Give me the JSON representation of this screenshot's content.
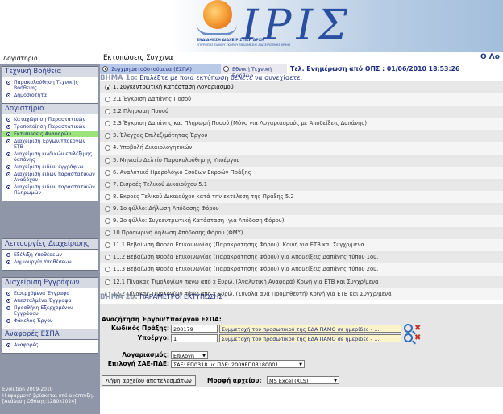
{
  "header": {
    "logo_text": "IPIΣ",
    "logo_subtitle": "ΕΝΔΙΑΜΕΣΗ ΔΙΑΧΕΙΡΙΣΤΙΚΗ ΑΡΧΗ",
    "logo_subtitle2": "ΕΠΙΤΡΟΠΗΣ ΕΙΔΙΚΟΥ ΣΚΟΠΟΥ ΕΝΔΙΑΜΕΣΗΣ ΔΙΑΧΕΙΡΙΣΤΙΚΗΣ ΑΡΧΗΣ"
  },
  "topbar": {
    "left": "Λογιστήριο",
    "title": "Εκτυπώσεις Συγχ/να",
    "right": "Ο Λο"
  },
  "sidebar": {
    "sections": [
      {
        "title": "Τεχνική Βοήθεια",
        "items": [
          "Παρακολούθηση Τεχνικής Βοήθειας",
          "Δημοσιότητα"
        ]
      },
      {
        "title": "Λογιστήριο",
        "items": [
          "Καταχώρηση Παραστατικών",
          "Τροποποίηση Παραστατικών",
          "Εκτυπώσεις Αναφορών",
          "Διαχείριση Έργων/Υποέργων ΕΤΒ",
          "Διαχείριση κωδικών επιλέξιμης δαπάνης",
          "Διαχείριση ειδών εγγράφων",
          "Διαχείριση ειδών παραστατικών Αναδόχου",
          "Διαχείριση ειδών παραστατικών Πληρωμών"
        ]
      },
      {
        "title": "Λειτουργίες Διαχείρισης",
        "items": [
          "Εξέλιξη Υποθέσεων",
          "Δημιουργία Υποθέσεων"
        ]
      },
      {
        "title": "Διαχείριση Εγγράφων",
        "items": [
          "Εισερχόμενα Έγγραφα",
          "Απεσταλμένα Έγγραφα",
          "Προσθήκη Εξερχομένου Εγγράφου",
          "Φάκελος Έργου"
        ]
      },
      {
        "title": "Αναφορές ΕΣΠΑ",
        "items": [
          "Αναφορές"
        ]
      }
    ],
    "active_item": "Εκτυπώσεις Αναφορών",
    "footer": [
      "Evolution 2009-2010",
      "Η εφαρμογή βρίσκεται υπό ανάπτυξη.",
      "[Ανάλυση Οθόνης:1280x1024]"
    ]
  },
  "main": {
    "tabs": [
      {
        "label": "Συγχρηματοδοτούμενα (ΕΣΠΑ)",
        "selected": true
      },
      {
        "label": "Εθνική Τεχνική Βοήθεια",
        "selected": false
      }
    ],
    "last_update": "Τελ. Ενημέρωση από ΟΠΣ : 01/06/2010 18:53:26",
    "step1_label": "ΒΗΜΑ 1ο:",
    "step1_text": "Επιλέξτε με ποια εκτύπωση θέλετε να συνεχίσετε:",
    "options": [
      "1. Συγκεντρωτική Κατάσταση Λογαριασμού",
      "2.1 Έγκριση Δαπάνης Ποσού",
      "2.2 Πληρωμή Ποσού",
      "2.3 Έγκριση Δαπάνης και Πληρωμή Ποσού (Μόνο για Λογαριασμούς με Αποδείξεις Δαπάνης)",
      "3. Έλεγχος Επιλεξιμότητας Έργου",
      "4. Υποβολή Δικαιολογητικών",
      "5. Μηνιαίο Δελτίο Παρακολούθησης Υποέργου",
      "6. Αναλυτικό Ημερολόγιο Εσόδων Εκροών Πράξης",
      "7. Εισροές Τελικού Δικαιούχου 5.1",
      "8. Εκροές Τελικού Δικαιούχου κατά την εκτέλεση της Πράξης 5.2",
      "9. 1ο φύλλο: Δήλωση Απόδοσης Φόρου",
      "9. 2ο φύλλο: Συγκεντρωτική Κατάσταση (για Απόδοση Φόρου)",
      "10.Προσωρινή Δήλωση Απόδοσης Φόρου (ΦΜΥ)",
      "11.1 Βεβαίωση Φορέα Επικοινωνίας (Παρακράτησης Φόρου). Κοινή για ΕΤΒ και Συγχρ/μενα",
      "11.2 Βεβαίωση Φορέα Επικοινωνίας (Παρακράτησης Φόρου) για Αποδείξεις Δαπάνης τύπου 1ου.",
      "11.3 Βεβαίωση Φορέα Επικοινωνίας (Παρακράτησης Φόρου) για Αποδείξεις Δαπάνης τύπου 2ου.",
      "12.1 Πίνακας Τιμολογίων πάνω από x Ευρώ. (Αναλυτική Αναφορά) Κοινή για ΕΤΒ και Συγχρ/μενα",
      "12.2 Πίνακας Τιμολογίων πάνω από x Ευρώ. (Σύνολα ανά Προμηθευτή) Κοινή για ΕΤΒ και Συγχρ/μενα"
    ],
    "selected_option": 0,
    "step2_label": "ΒΗΜΑ 2ο:",
    "step2_text": "ΠΑΡΑΜΕΤΡΟΙ ΕΚΤΥΠΩΣΗΣ",
    "search_title": "Αναζήτηση Έργου/Υποέργου ΕΣΠΑ:",
    "project_code_label": "Κωδικός Πράξης:",
    "project_code_value": "200179",
    "project_desc": "Συμμετοχή του προσωπικού της ΕΔΑ ΠΑΜΟ σε ημερίδες - ...",
    "subproject_label": "Υποέργο:",
    "subproject_value": "1",
    "subproject_desc": "Συμμετοχή του προσωπικού της ΕΔΑ ΠΑΜΟ σε ημερίδες - ...",
    "account_label": "Λογαριασμός:",
    "account_value": "Επιλογή",
    "sae_label": "Επιλογή ΣΑΕ-ΠΔΕ:",
    "sae_value": "ΣΑΕ: ΕΠ0318 με ΠΔΕ: 2009ΕΠ03180001",
    "button_get": "Λήψη αρχείου αποτελεσμάτων",
    "format_label": "Μορφή αρχείου:",
    "format_value": "MS Excel (XLS)"
  },
  "colors": {
    "accent_blue": "#1c2d80",
    "sidebar_bg": "#8f96a8",
    "active_green": "#9de27a",
    "input_yellow": "#fbf3c9"
  }
}
